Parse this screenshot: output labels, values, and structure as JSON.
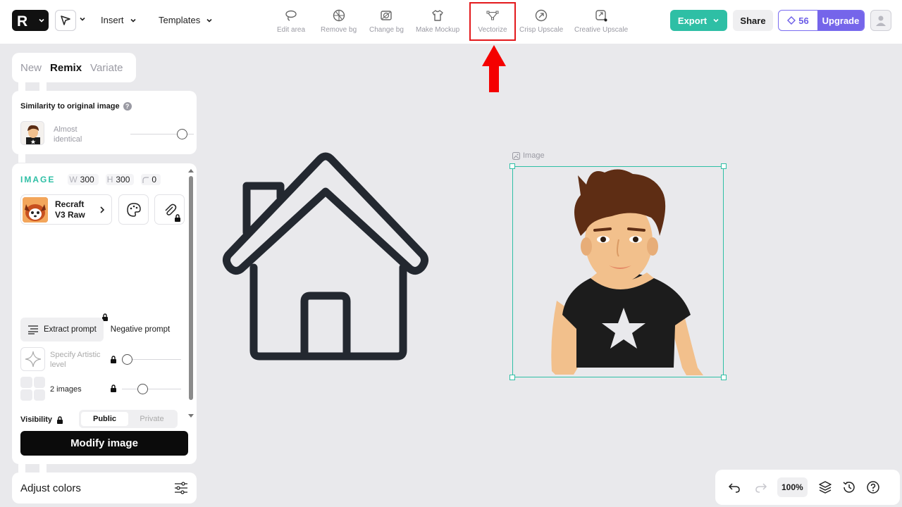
{
  "toolbar": {
    "insert_label": "Insert",
    "templates_label": "Templates",
    "tools": [
      {
        "label": "Edit area",
        "icon": "lasso-icon"
      },
      {
        "label": "Remove bg",
        "icon": "remove-bg-icon"
      },
      {
        "label": "Change bg",
        "icon": "change-bg-icon"
      },
      {
        "label": "Make Mockup",
        "icon": "tshirt-icon"
      },
      {
        "label": "Vectorize",
        "icon": "vector-nodes-icon"
      },
      {
        "label": "Crisp Upscale",
        "icon": "upscale-icon"
      },
      {
        "label": "Creative Upscale",
        "icon": "creative-upscale-icon"
      }
    ],
    "export_label": "Export",
    "share_label": "Share",
    "credits": "56",
    "upgrade_label": "Upgrade"
  },
  "panel": {
    "tabs": [
      "New",
      "Remix",
      "Variate"
    ],
    "active_tab": "Remix",
    "similarity_title": "Similarity to original image",
    "similarity_value": "Almost identical",
    "image_heading": "IMAGE",
    "width_key": "W",
    "width": "300",
    "height_key": "H",
    "height": "300",
    "rotation": "0",
    "model_name": "Recraft V3 Raw",
    "extract_prompt": "Extract prompt",
    "negative_prompt": "Negative prompt",
    "artistic_level": "Specify Artistic level",
    "images_count": "2 images",
    "visibility_label": "Visibility",
    "public_label": "Public",
    "private_label": "Private",
    "modify_button": "Modify image",
    "adjust_colors": "Adjust colors"
  },
  "canvas": {
    "frame_label": "Image"
  },
  "bottom": {
    "zoom": "100%"
  },
  "colors": {
    "accent": "#2ebfa5",
    "upgrade": "#7565ea",
    "annotation": "#e3191c"
  }
}
